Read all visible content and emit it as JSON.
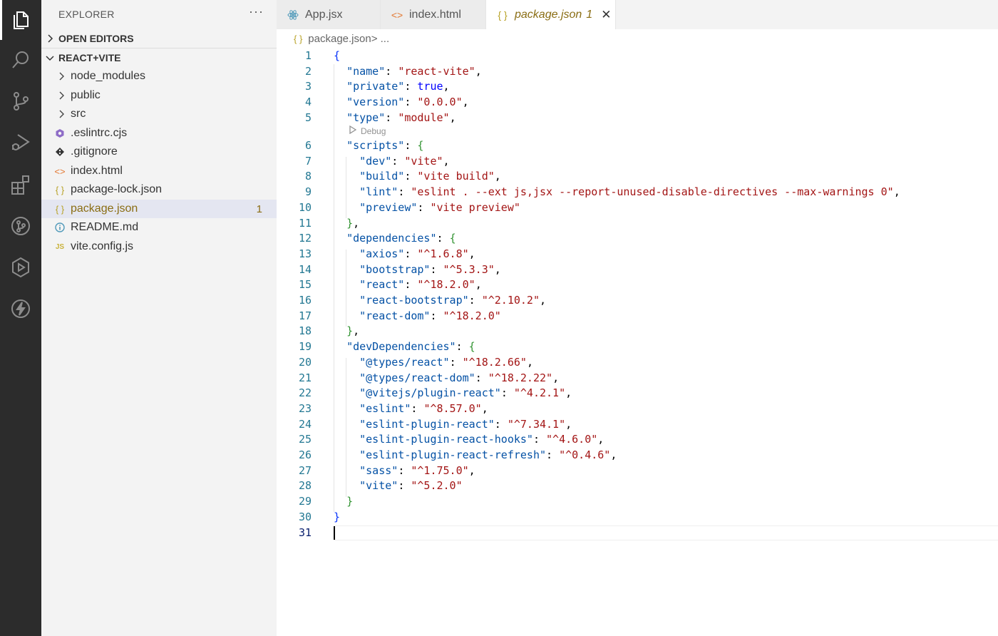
{
  "activity_bar": {
    "items": [
      {
        "icon": "files-icon",
        "active": true
      },
      {
        "icon": "search-icon"
      },
      {
        "icon": "source-control-icon"
      },
      {
        "icon": "run-debug-icon"
      },
      {
        "icon": "extensions-icon"
      },
      {
        "icon": "git-graph-icon"
      },
      {
        "icon": "deploy-icon"
      },
      {
        "icon": "lightning-icon"
      }
    ]
  },
  "explorer": {
    "title": "EXPLORER",
    "more": "···",
    "open_editors_label": "OPEN EDITORS",
    "project_label": "REACT+VITE",
    "items": [
      {
        "label": "node_modules",
        "type": "folder"
      },
      {
        "label": "public",
        "type": "folder"
      },
      {
        "label": "src",
        "type": "folder"
      },
      {
        "label": ".eslintrc.cjs",
        "type": "eslint"
      },
      {
        "label": ".gitignore",
        "type": "git"
      },
      {
        "label": "index.html",
        "type": "html"
      },
      {
        "label": "package-lock.json",
        "type": "json"
      },
      {
        "label": "package.json",
        "type": "json",
        "selected": true,
        "badge": "1"
      },
      {
        "label": "README.md",
        "type": "info"
      },
      {
        "label": "vite.config.js",
        "type": "js"
      }
    ]
  },
  "tabs": [
    {
      "label": "App.jsx",
      "icon": "react-icon"
    },
    {
      "label": "index.html",
      "icon": "html-icon"
    },
    {
      "label": "package.json",
      "icon": "json-icon",
      "active": true,
      "badge": "1",
      "close": "✕"
    }
  ],
  "breadcrumb": {
    "icon": "{ }",
    "file": "package.json",
    "rest": " > ..."
  },
  "codelens": {
    "label": "Debug"
  },
  "editor": {
    "lines": [
      "1",
      "2",
      "3",
      "4",
      "5",
      "6",
      "7",
      "8",
      "9",
      "10",
      "11",
      "12",
      "13",
      "14",
      "15",
      "16",
      "17",
      "18",
      "19",
      "20",
      "21",
      "22",
      "23",
      "24",
      "25",
      "26",
      "27",
      "28",
      "29",
      "30",
      "31"
    ],
    "code": {
      "name_key": "\"name\"",
      "name_val": "\"react-vite\"",
      "private_key": "\"private\"",
      "private_val": "true",
      "version_key": "\"version\"",
      "version_val": "\"0.0.0\"",
      "type_key": "\"type\"",
      "type_val": "\"module\"",
      "scripts_key": "\"scripts\"",
      "dev_key": "\"dev\"",
      "dev_val": "\"vite\"",
      "build_key": "\"build\"",
      "build_val": "\"vite build\"",
      "lint_key": "\"lint\"",
      "lint_val": "\"eslint . --ext js,jsx --report-unused-disable-directives --max-warnings 0\"",
      "preview_key": "\"preview\"",
      "preview_val": "\"vite preview\"",
      "deps_key": "\"dependencies\"",
      "axios_key": "\"axios\"",
      "axios_val": "\"^1.6.8\"",
      "bootstrap_key": "\"bootstrap\"",
      "bootstrap_val": "\"^5.3.3\"",
      "react_key": "\"react\"",
      "react_val": "\"^18.2.0\"",
      "rb_key": "\"react-bootstrap\"",
      "rb_val": "\"^2.10.2\"",
      "rd_key": "\"react-dom\"",
      "rd_val": "\"^18.2.0\"",
      "devdeps_key": "\"devDependencies\"",
      "tr_key": "\"@types/react\"",
      "tr_val": "\"^18.2.66\"",
      "trd_key": "\"@types/react-dom\"",
      "trd_val": "\"^18.2.22\"",
      "vpr_key": "\"@vitejs/plugin-react\"",
      "vpr_val": "\"^4.2.1\"",
      "eslint_key": "\"eslint\"",
      "eslint_val": "\"^8.57.0\"",
      "epr_key": "\"eslint-plugin-react\"",
      "epr_val": "\"^7.34.1\"",
      "eprh_key": "\"eslint-plugin-react-hooks\"",
      "eprh_val": "\"^4.6.0\"",
      "eprr_key": "\"eslint-plugin-react-refresh\"",
      "eprr_val": "\"^0.4.6\"",
      "sass_key": "\"sass\"",
      "sass_val": "\"^1.75.0\"",
      "vite_key": "\"vite\"",
      "vite_val": "\"^5.2.0\""
    }
  }
}
